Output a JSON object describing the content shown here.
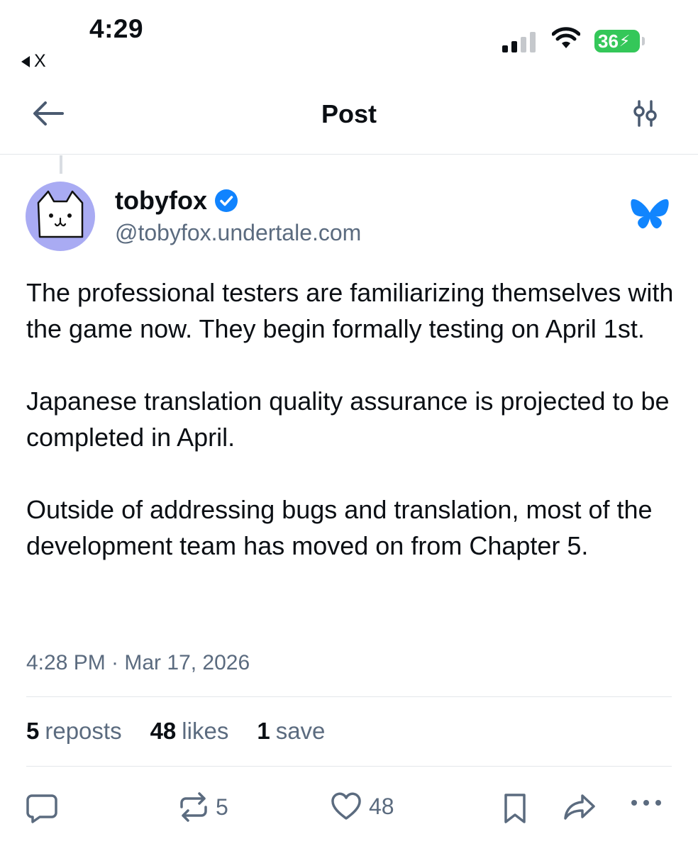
{
  "status_bar": {
    "time": "4:29",
    "back_app": "X",
    "battery": "36"
  },
  "header": {
    "title": "Post"
  },
  "post": {
    "author_name": "tobyfox",
    "author_handle": "@tobyfox.undertale.com",
    "paragraphs": [
      "The professional testers are familiarizing themselves with the game now. They begin formally testing on April 1st.",
      "Japanese translation quality assurance is projected to be completed in April.",
      "Outside of addressing bugs and translation, most of the development team has moved on from Chapter 5."
    ],
    "timestamp": "4:28 PM · Mar 17, 2026"
  },
  "stats": {
    "reposts_count": "5",
    "reposts_label": "reposts",
    "likes_count": "48",
    "likes_label": "likes",
    "saves_count": "1",
    "saves_label": "save"
  },
  "actions": {
    "repost_count": "5",
    "like_count": "48"
  },
  "colors": {
    "verified": "#1083fe",
    "butterfly": "#1185fe",
    "secondary_text": "#5b6b7f",
    "battery": "#34c759",
    "avatar_bg": "#a9abf3"
  },
  "icons": [
    "back-arrow-icon",
    "settings-sliders-icon",
    "verified-badge-icon",
    "bluesky-butterfly-icon",
    "reply-icon",
    "repost-icon",
    "like-icon",
    "bookmark-icon",
    "share-icon",
    "more-icon"
  ]
}
